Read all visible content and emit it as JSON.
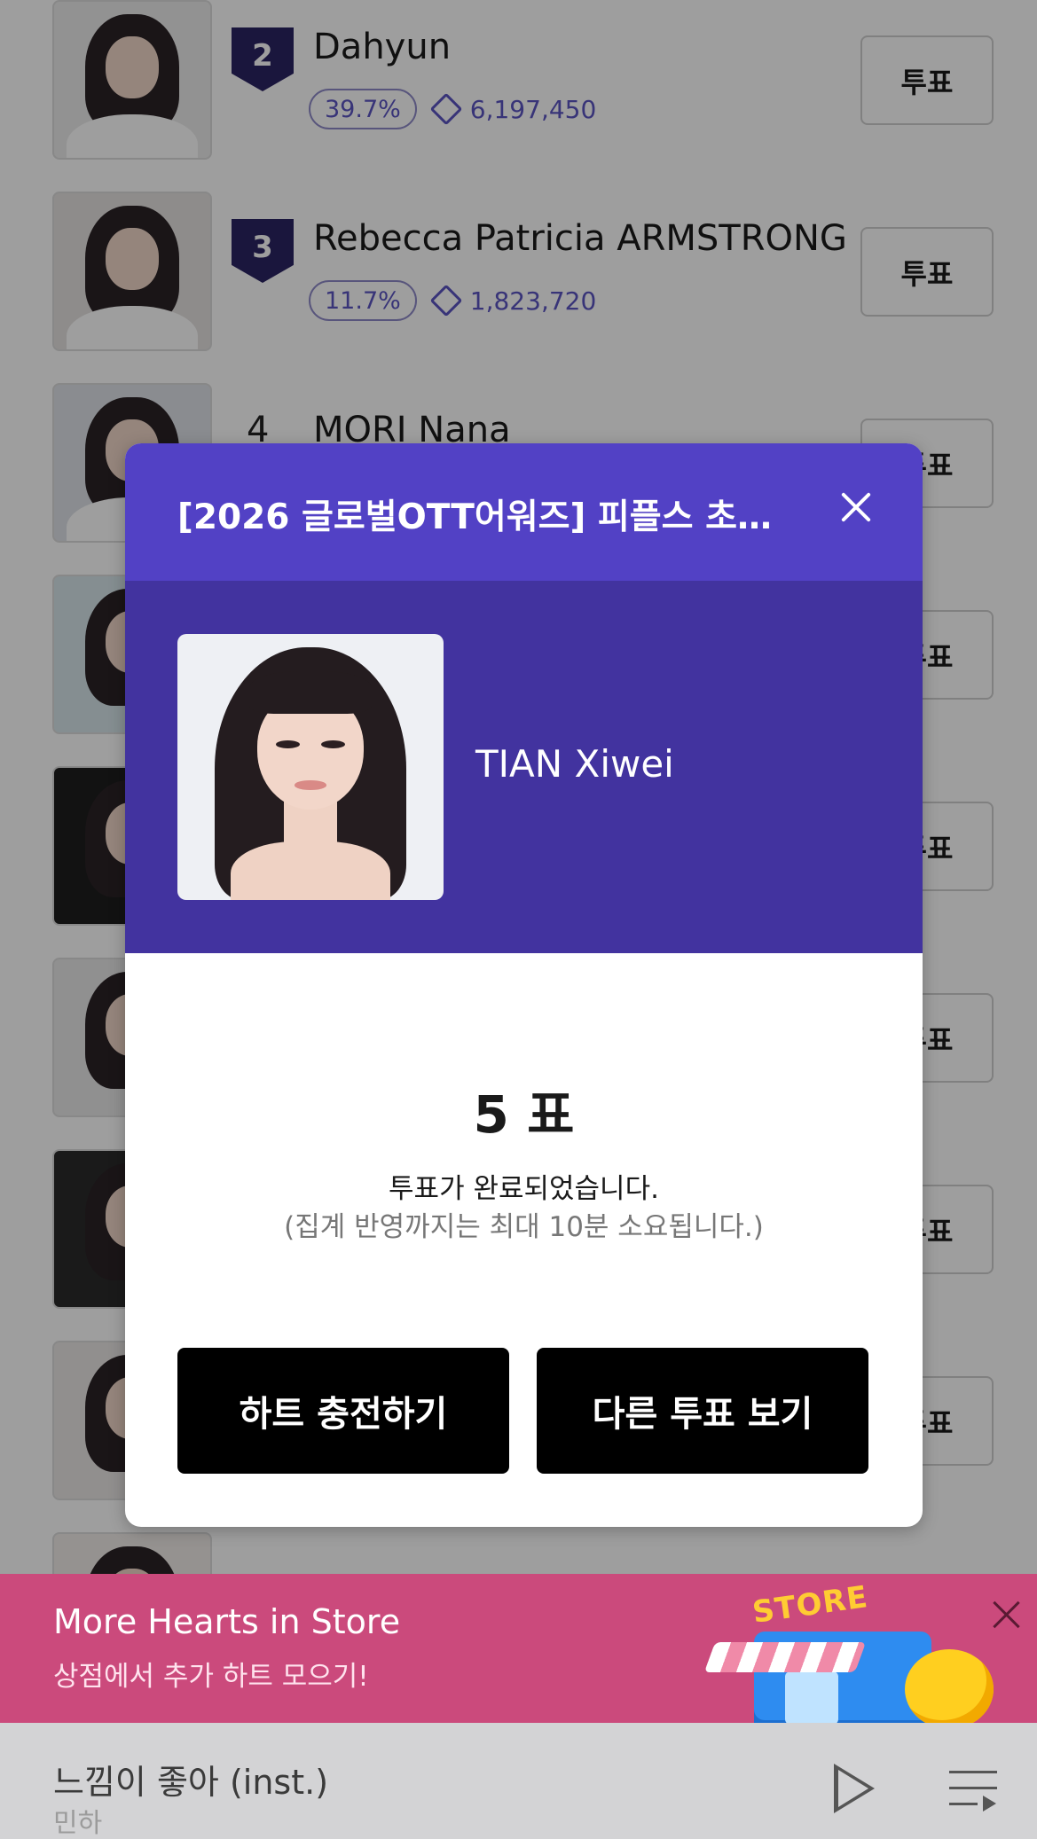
{
  "ranking": {
    "vote_button_label": "투표",
    "rows": [
      {
        "rank": "2",
        "name": "Dahyun",
        "percent": "39.7%",
        "votes": "6,197,450"
      },
      {
        "rank": "3",
        "name": "Rebecca Patricia ARMSTRONG",
        "percent": "11.7%",
        "votes": "1,823,720"
      },
      {
        "rank": "4",
        "name": "MORI Nana",
        "percent": "",
        "votes": ""
      }
    ]
  },
  "modal": {
    "title": "[2026 글로벌OTT어워즈] 피플스 초이...",
    "candidate_name": "TIAN Xiwei",
    "vote_result": "5 표",
    "message": "투표가 완료되었습니다.",
    "sub_message": "(집계 반영까지는 최대 10분 소요됩니다.)",
    "charge_button": "하트 충전하기",
    "other_votes_button": "다른 투표 보기"
  },
  "store_banner": {
    "title": "More Hearts in Store",
    "subtitle": "상점에서 추가 하트 모으기!",
    "sign": "STORE"
  },
  "player": {
    "track_title": "느낌이 좋아 (inst.)",
    "artist": "민하"
  },
  "colors": {
    "modal_header": "#5241c5",
    "candidate_band": "#42339f",
    "rank_badge": "#2b2463",
    "accent_text": "#5b54c2",
    "banner": "#cb4a7c",
    "player_bg": "#d3d3d5"
  },
  "icons": [
    "close-icon",
    "diamond-icon",
    "play-icon",
    "playlist-icon",
    "store-illustration"
  ]
}
